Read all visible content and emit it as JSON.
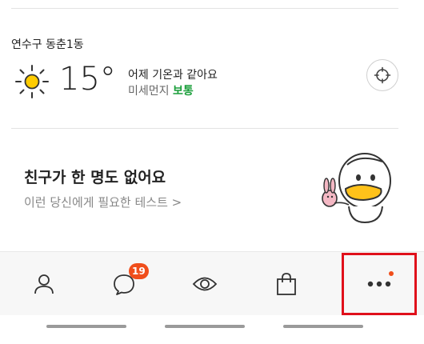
{
  "weather": {
    "location": "연수구 동춘1동",
    "temperature": "15°",
    "comparison": "어제 기온과 같아요",
    "dust_label": "미세먼지",
    "dust_status": "보통"
  },
  "friends": {
    "title": "친구가 한 명도 없어요",
    "subtitle": "이런 당신에게 필요한 테스트 >"
  },
  "tabbar": {
    "chat_badge": "19",
    "tabs": [
      {
        "icon": "person-icon"
      },
      {
        "icon": "chat-bubble-icon"
      },
      {
        "icon": "eye-view-icon"
      },
      {
        "icon": "shopping-bag-icon"
      },
      {
        "icon": "more-dots-icon"
      }
    ]
  },
  "colors": {
    "accent": "#f04e1b",
    "good_status": "#1a9e3a",
    "highlight": "#e0101b"
  }
}
